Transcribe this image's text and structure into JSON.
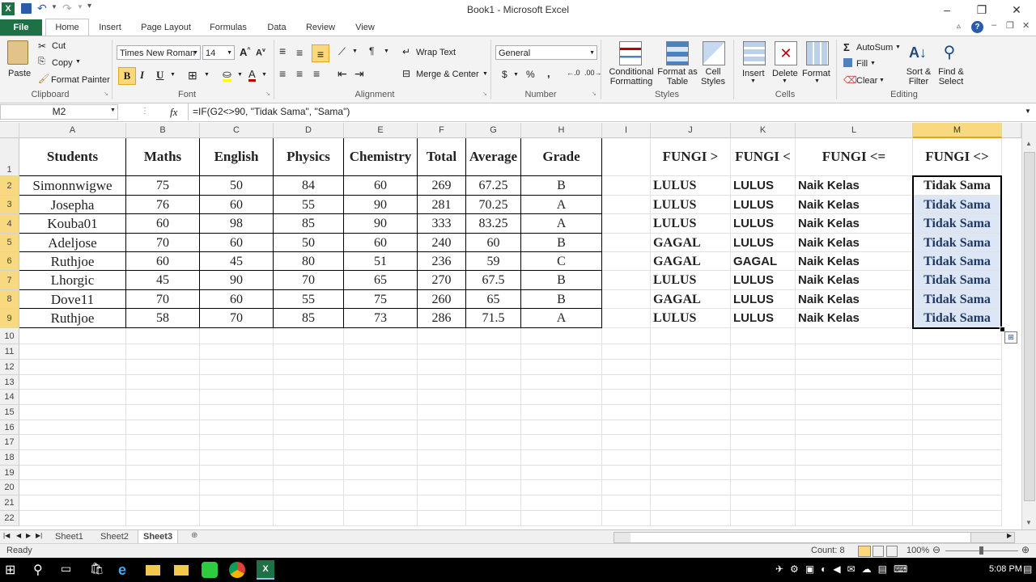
{
  "window": {
    "title": "Book1  -  Microsoft Excel"
  },
  "tabs": [
    "File",
    "Home",
    "Insert",
    "Page Layout",
    "Formulas",
    "Data",
    "Review",
    "View"
  ],
  "clipboard": {
    "paste": "Paste",
    "cut": "Cut",
    "copy": "Copy",
    "format_painter": "Format Painter",
    "label": "Clipboard"
  },
  "font": {
    "name": "Times New Roman",
    "size": "14",
    "label": "Font"
  },
  "alignment": {
    "wrap_text": "Wrap Text",
    "merge_center": "Merge & Center",
    "label": "Alignment"
  },
  "number": {
    "format": "General",
    "label": "Number"
  },
  "styles": {
    "conditional_formatting": "Conditional Formatting",
    "format_as_table": "Format as Table",
    "cell_styles": "Cell Styles",
    "label": "Styles"
  },
  "cells_group": {
    "insert": "Insert",
    "delete": "Delete",
    "format": "Format",
    "label": "Cells"
  },
  "editing": {
    "autosum": "AutoSum",
    "fill": "Fill",
    "clear": "Clear",
    "sort_filter": "Sort & Filter",
    "find_select": "Find & Select",
    "label": "Editing"
  },
  "formula_bar": {
    "name_box": "M2",
    "fx": "fx",
    "formula": "=IF(G2<>90, \"Tidak Sama\", \"Sama\")"
  },
  "columns": [
    "A",
    "B",
    "C",
    "D",
    "E",
    "F",
    "G",
    "H",
    "I",
    "J",
    "K",
    "L",
    "M"
  ],
  "selected_column": "M",
  "rows": [
    "1",
    "2",
    "3",
    "4",
    "5",
    "6",
    "7",
    "8",
    "9",
    "10",
    "11",
    "12",
    "13",
    "14",
    "15",
    "16",
    "17",
    "18",
    "19",
    "20",
    "21",
    "22"
  ],
  "headers": [
    "Students",
    "Maths",
    "English",
    "Physics",
    "Chemistry",
    "Total",
    "Average",
    "Grade",
    "",
    "FUNGI >",
    "FUNGI <",
    "FUNGI <=",
    "FUNGI <>"
  ],
  "data": [
    [
      "Simonnwigwe",
      "75",
      "50",
      "84",
      "60",
      "269",
      "67.25",
      "B",
      "",
      "LULUS",
      "LULUS",
      "Naik Kelas",
      "Tidak Sama"
    ],
    [
      "Josepha",
      "76",
      "60",
      "55",
      "90",
      "281",
      "70.25",
      "A",
      "",
      "LULUS",
      "LULUS",
      "Naik Kelas",
      "Tidak Sama"
    ],
    [
      "Kouba01",
      "60",
      "98",
      "85",
      "90",
      "333",
      "83.25",
      "A",
      "",
      "LULUS",
      "LULUS",
      "Naik Kelas",
      "Tidak Sama"
    ],
    [
      "Adeljose",
      "70",
      "60",
      "50",
      "60",
      "240",
      "60",
      "B",
      "",
      "GAGAL",
      "LULUS",
      "Naik Kelas",
      "Tidak Sama"
    ],
    [
      "Ruthjoe",
      "60",
      "45",
      "80",
      "51",
      "236",
      "59",
      "C",
      "",
      "GAGAL",
      "GAGAL",
      "Naik Kelas",
      "Tidak Sama"
    ],
    [
      "Lhorgic",
      "45",
      "90",
      "70",
      "65",
      "270",
      "67.5",
      "B",
      "",
      "LULUS",
      "LULUS",
      "Naik Kelas",
      "Tidak Sama"
    ],
    [
      "Dove11",
      "70",
      "60",
      "55",
      "75",
      "260",
      "65",
      "B",
      "",
      "GAGAL",
      "LULUS",
      "Naik Kelas",
      "Tidak Sama"
    ],
    [
      "Ruthjoe",
      "58",
      "70",
      "85",
      "73",
      "286",
      "71.5",
      "A",
      "",
      "LULUS",
      "LULUS",
      "Naik Kelas",
      "Tidak Sama"
    ]
  ],
  "sheets": [
    "Sheet1",
    "Sheet2",
    "Sheet3"
  ],
  "active_sheet": "Sheet3",
  "status": {
    "ready": "Ready",
    "count": "Count: 8",
    "zoom": "100%"
  },
  "taskbar": {
    "time": "5:08 PM"
  },
  "colors": {
    "excel_green": "#1e7145",
    "selection_fill": "#dce6f4",
    "header_selected": "#f9d97f"
  }
}
